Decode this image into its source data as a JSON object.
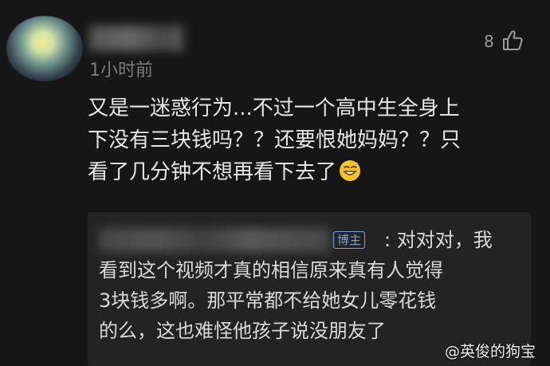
{
  "comment": {
    "timestamp": "1小时前",
    "like_count": "8",
    "lines": [
      "又是一迷惑行为...不过一个高中生全身上",
      "下没有三块钱吗？？还要恨她妈妈？？只",
      "看了几分钟不想再看下去了"
    ],
    "emoji": "grinning-sweat-emoji"
  },
  "reply": {
    "badge": "博主",
    "lines": [
      ": 对对对，我",
      "看到这个视频才真的相信原来真有人觉得",
      "3块钱多啊。那平常都不给她女儿零花钱",
      "的么，这也难怪他孩子说没朋友了"
    ]
  },
  "watermark": "@英俊的狗宝",
  "colors": {
    "background": "#161616",
    "reply_background": "#232323",
    "badge": "#6fa6dd"
  }
}
